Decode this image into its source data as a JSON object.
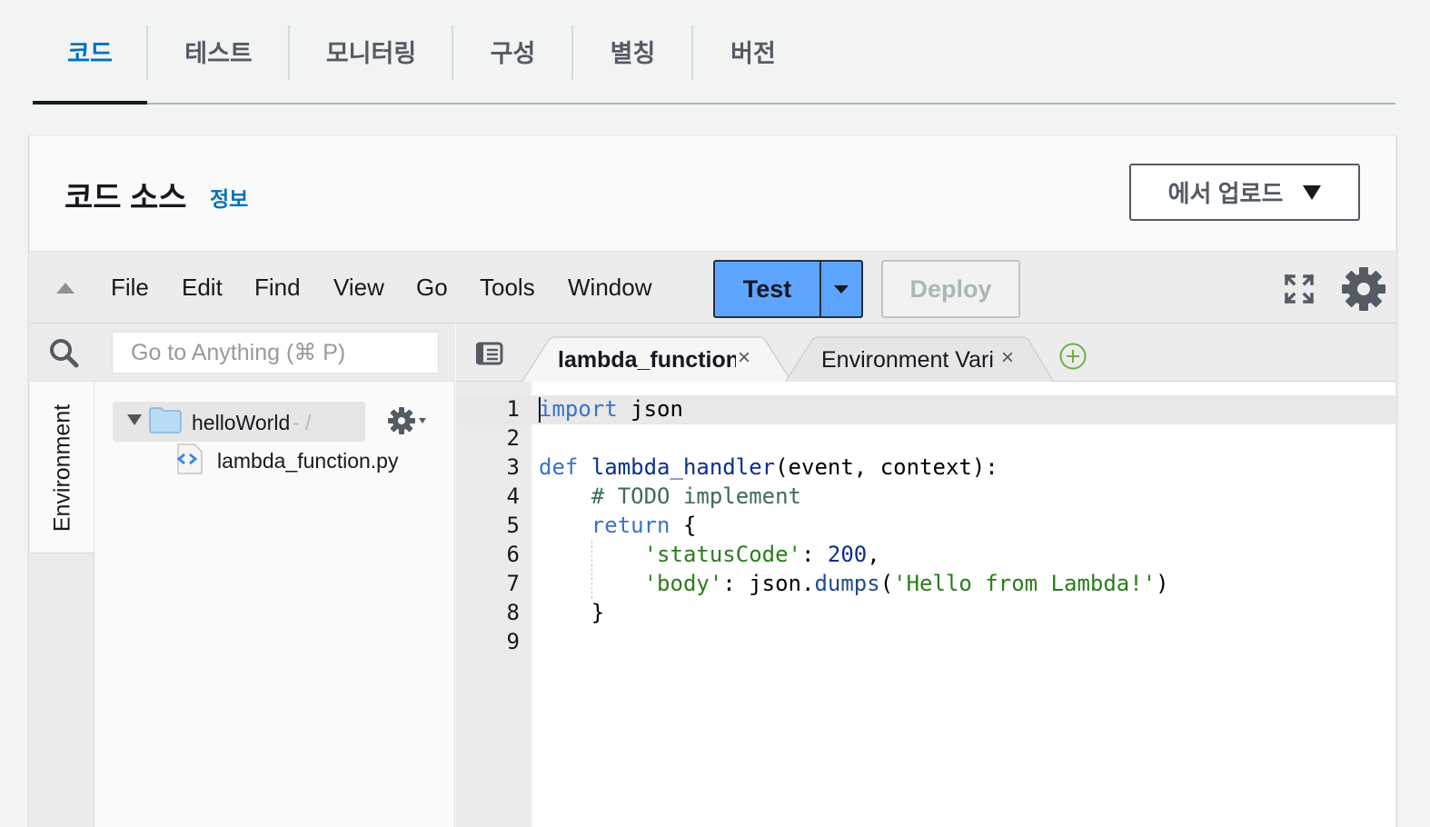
{
  "tabs": [
    {
      "label": "코드",
      "active": true
    },
    {
      "label": "테스트"
    },
    {
      "label": "모니터링"
    },
    {
      "label": "구성"
    },
    {
      "label": "별칭"
    },
    {
      "label": "버전"
    }
  ],
  "panel": {
    "title": "코드 소스",
    "info_link": "정보",
    "upload_button": "에서 업로드"
  },
  "menubar": {
    "items": [
      "File",
      "Edit",
      "Find",
      "View",
      "Go",
      "Tools",
      "Window"
    ],
    "test_button": "Test",
    "deploy_button": "Deploy"
  },
  "sidebar": {
    "search_placeholder": "Go to Anything (⌘ P)",
    "rail_label": "Environment",
    "root_folder": "helloWorld",
    "root_path": "- /",
    "file": "lambda_function.py"
  },
  "editor": {
    "tabs": [
      {
        "label": "lambda_function",
        "active": true
      },
      {
        "label": "Environment Vari",
        "active": false
      }
    ],
    "line_numbers": [
      "1",
      "2",
      "3",
      "4",
      "5",
      "6",
      "7",
      "8",
      "9"
    ],
    "code": {
      "l1_kw": "import",
      "l1_rest": " json",
      "l3_kw": "def",
      "l3_fn": " lambda_handler",
      "l3_rest": "(event, context):",
      "l4_comment": "    # TODO implement",
      "l5_indent": "    ",
      "l5_kw": "return",
      "l5_rest": " {",
      "l6_indent": "        ",
      "l6_str": "'statusCode'",
      "l6_colon": ": ",
      "l6_num": "200",
      "l6_comma": ",",
      "l7_indent": "        ",
      "l7_str": "'body'",
      "l7_mid": ": json.",
      "l7_method": "dumps",
      "l7_paren": "(",
      "l7_arg": "'Hello from Lambda!'",
      "l7_close": ")",
      "l8": "    }"
    }
  },
  "colors": {
    "accent": "#0073bb",
    "test_button": "#5ea5ff",
    "keyword": "#3a73c9",
    "string": "#2a7d1a",
    "comment": "#3d6b5c"
  }
}
